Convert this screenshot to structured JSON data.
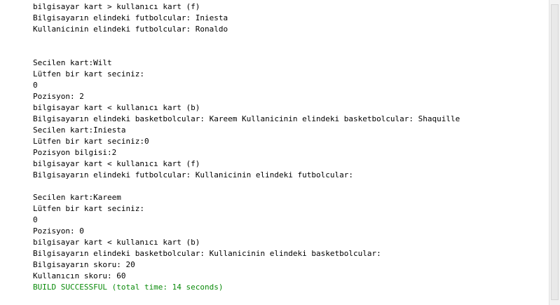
{
  "output": {
    "lines": [
      {
        "text": "bilgisayar kart > kullanıcı kart (f)",
        "type": "normal"
      },
      {
        "text": "Bilgisayarın elindeki futbolcular: Iniesta",
        "type": "normal"
      },
      {
        "text": "Kullanicinin elindeki futbolcular: Ronaldo",
        "type": "normal"
      },
      {
        "text": "",
        "type": "normal"
      },
      {
        "text": "",
        "type": "normal"
      },
      {
        "text": "Secilen kart:Wilt",
        "type": "normal"
      },
      {
        "text": "Lütfen bir kart seciniz:",
        "type": "normal"
      },
      {
        "text": "0",
        "type": "normal"
      },
      {
        "text": "Pozisyon: 2",
        "type": "normal"
      },
      {
        "text": "bilgisayar kart < kullanıcı kart (b)",
        "type": "normal"
      },
      {
        "text": "Bilgisayarın elindeki basketbolcular: Kareem Kullanicinin elindeki basketbolcular: Shaquille",
        "type": "normal"
      },
      {
        "text": "Secilen kart:Iniesta",
        "type": "normal"
      },
      {
        "text": "Lütfen bir kart seciniz:0",
        "type": "normal"
      },
      {
        "text": "Pozisyon bilgisi:2",
        "type": "normal"
      },
      {
        "text": "bilgisayar kart < kullanıcı kart (f)",
        "type": "normal"
      },
      {
        "text": "Bilgisayarın elindeki futbolcular: Kullanicinin elindeki futbolcular:",
        "type": "normal"
      },
      {
        "text": "",
        "type": "normal"
      },
      {
        "text": "Secilen kart:Kareem",
        "type": "normal"
      },
      {
        "text": "Lütfen bir kart seciniz:",
        "type": "normal"
      },
      {
        "text": "0",
        "type": "normal"
      },
      {
        "text": "Pozisyon: 0",
        "type": "normal"
      },
      {
        "text": "bilgisayar kart < kullanıcı kart (b)",
        "type": "normal"
      },
      {
        "text": "Bilgisayarın elindeki basketbolcular: Kullanicinin elindeki basketbolcular:",
        "type": "normal"
      },
      {
        "text": "Bilgisayarın skoru: 20",
        "type": "normal"
      },
      {
        "text": "Kullanıcın skoru: 60",
        "type": "normal"
      },
      {
        "text": "BUILD SUCCESSFUL (total time: 14 seconds)",
        "type": "success"
      }
    ]
  },
  "colors": {
    "text": "#000000",
    "success": "#0a8a0a",
    "background": "#ffffff"
  }
}
